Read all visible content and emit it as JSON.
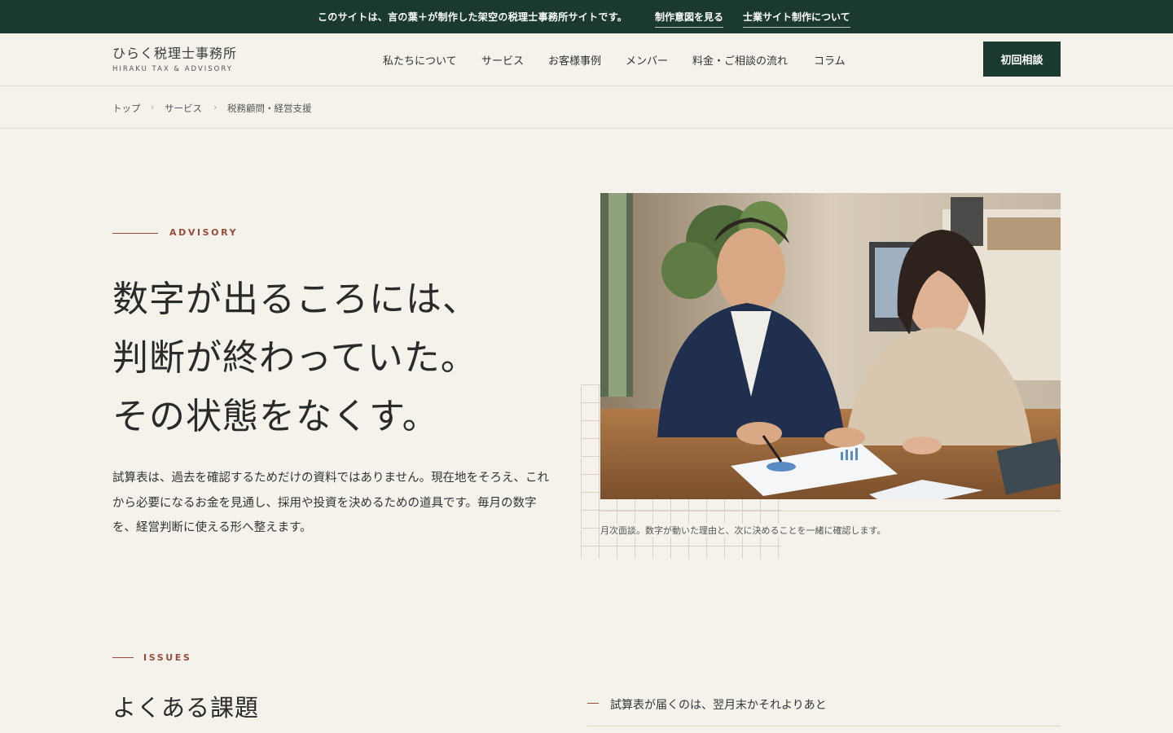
{
  "notice": {
    "message": "このサイトは、言の葉＋が制作した架空の税理士事務所サイトです。",
    "link1": "制作意図を見る",
    "link2": "士業サイト制作について"
  },
  "header": {
    "logo": "ひらく税理士事務所",
    "logo_sub": "HIRAKU TAX & ADVISORY",
    "nav": [
      "私たちについて",
      "サービス",
      "お客様事例",
      "メンバー",
      "料金・ご相談の流れ",
      "コラム"
    ],
    "cta": "初回相談"
  },
  "breadcrumb": {
    "items": [
      "トップ",
      "サービス",
      "税務顧問・経営支援"
    ],
    "separator": "›"
  },
  "hero": {
    "eyebrow": "ADVISORY",
    "headline": [
      "数字が出るころには、",
      "判断が終わっていた。",
      "その状態をなくす。"
    ],
    "lead": "試算表は、過去を確認するためだけの資料ではありません。現在地をそろえ、これから必要になるお金を見通し、採用や投資を決めるための道具です。毎月の数字を、経営判断に使える形へ整えます。",
    "caption": "月次面談。数字が動いた理由と、次に決めることを一緒に確認します。"
  },
  "issues": {
    "eyebrow": "ISSUES",
    "title": "よくある課題",
    "first_item": "試算表が届くのは、翌月末かそれよりあと"
  },
  "colors": {
    "brand_green": "#1b3a2f",
    "accent_rust": "#9a4b3a",
    "background": "#f5f2ec"
  }
}
